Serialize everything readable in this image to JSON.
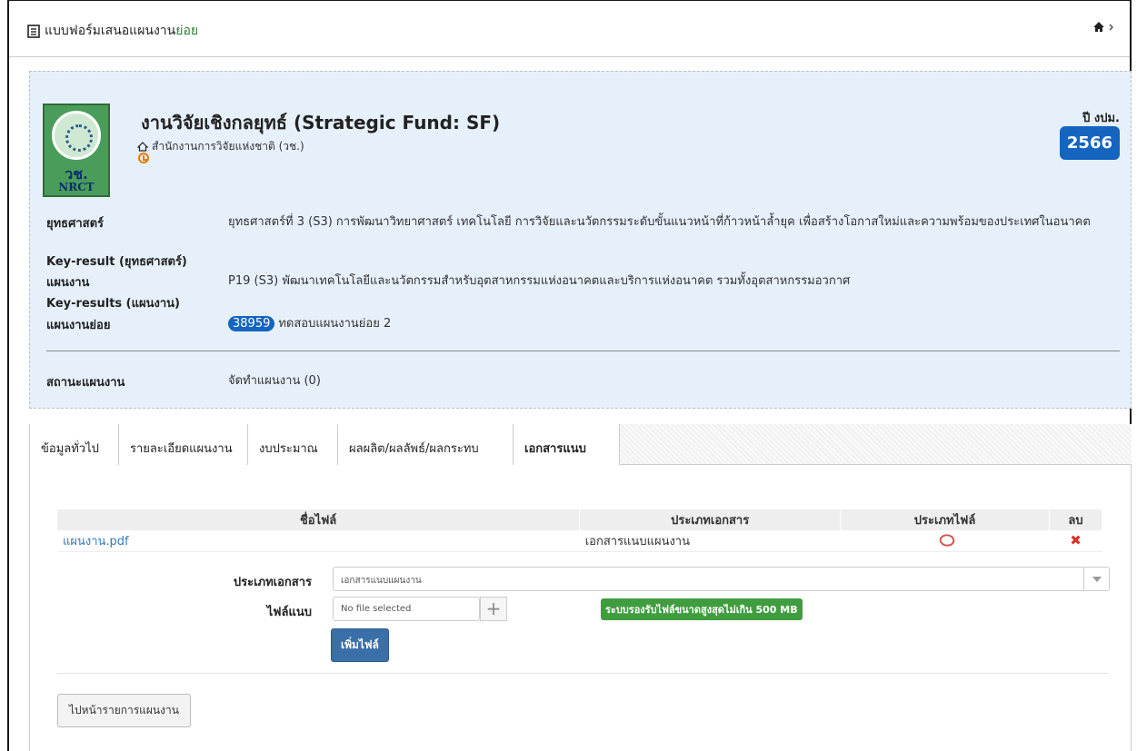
{
  "header": {
    "title_prefix": "แบบฟอร์มเสนอแผนงาน",
    "title_accent": "ย่อย"
  },
  "fund": {
    "title": "งานวิจัยเชิงกลยุทธ์ (Strategic Fund: SF)",
    "agency": "สำนักงานการวิจัยแห่งชาติ (วช.)",
    "year_label": "ปี งปม.",
    "year": "2566",
    "logo_abbr": "วช.",
    "logo_text": "NRCT"
  },
  "details": {
    "strategy_label": "ยุทธศาสตร์",
    "strategy_value": "ยุทธศาสตร์ที่ 3 (S3) การพัฒนาวิทยาศาสตร์ เทคโนโลยี การวิจัยและนวัตกรรมระดับขั้นแนวหน้าที่ก้าวหน้าล้ำยุค เพื่อสร้างโอกาสใหม่และความพร้อมของประเทศในอนาคต",
    "kr_strategy_label": "Key-result (ยุทธศาสตร์)",
    "plan_label": "แผนงาน",
    "plan_value": "P19 (S3) พัฒนาเทคโนโลยีและนวัตกรรมสำหรับอุตสาหกรรมแห่งอนาคตและบริการแห่งอนาคต รวมทั้งอุตสาหกรรมอวกาศ",
    "kr_plan_label": "Key-results (แผนงาน)",
    "subplan_label": "แผนงานย่อย",
    "subplan_id": "38959",
    "subplan_name": "ทดสอบแผนงานย่อย 2",
    "status_label": "สถานะแผนงาน",
    "status_value": "จัดทำแผนงาน (0)"
  },
  "tabs": [
    "ข้อมูลทั่วไป",
    "รายละเอียดแผนงาน",
    "งบประมาณ",
    "ผลผลิต/ผลลัพธ์/ผลกระทบ",
    "เอกสารแนบ"
  ],
  "files_table": {
    "headers": [
      "ชื่อไฟล์",
      "ประเภทเอกสาร",
      "ประเภทไฟล์",
      "ลบ"
    ],
    "rows": [
      {
        "name": "แผนงาน.pdf",
        "doc_type": "เอกสารแนบแผนงาน"
      }
    ]
  },
  "form": {
    "doc_type_label": "ประเภทเอกสาร",
    "doc_type_value": "เอกสารแนบแผนงาน",
    "file_label": "ไฟล์แนบ",
    "file_placeholder": "No file selected",
    "size_note": "ระบบรองรับไฟล์ขนาดสูงสุดไม่เกิน 500 MB",
    "add_button": "เพิ่มไฟล์"
  },
  "back_button": "ไปหน้ารายการแผนงาน",
  "colors": {
    "accent_green": "#2e7d32",
    "badge_blue": "#1565c0",
    "panel_bg": "#e6f0fb"
  }
}
